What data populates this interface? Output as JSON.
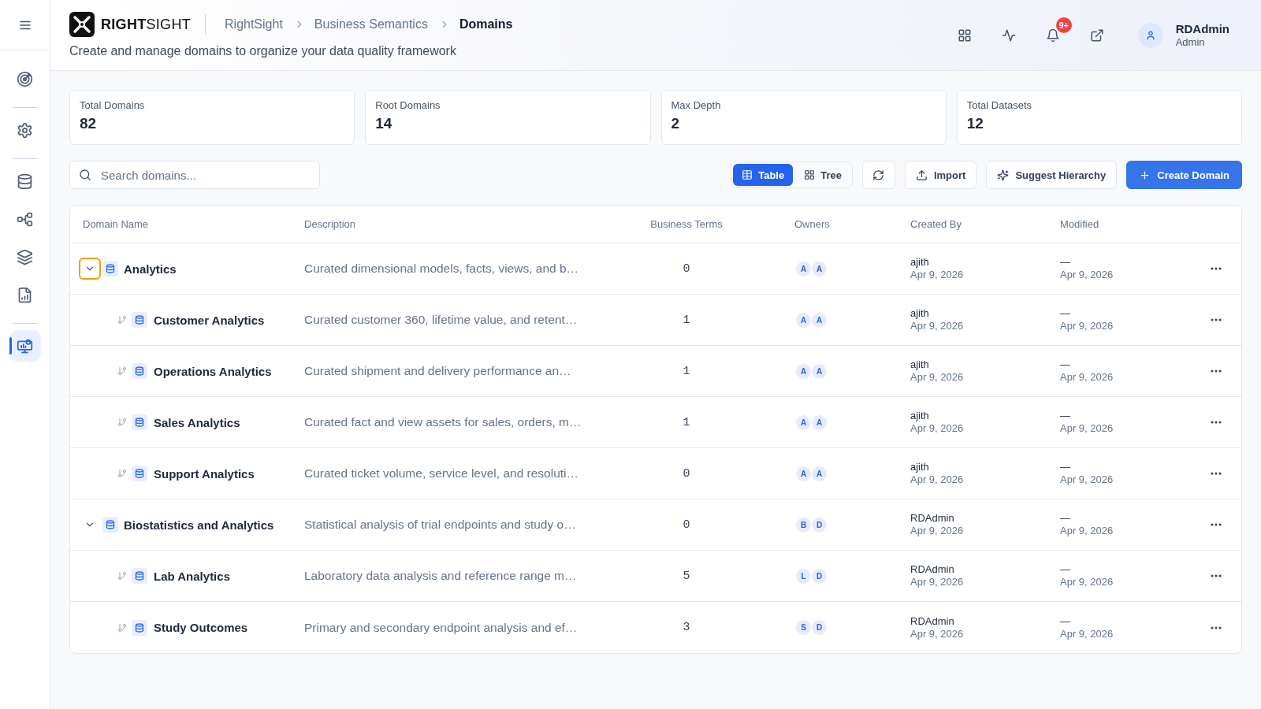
{
  "sidebar": {
    "groups": [
      [
        {
          "selected": false
        }
      ],
      [
        {
          "selected": false
        }
      ],
      [
        {
          "selected": false
        },
        {
          "selected": false
        },
        {
          "selected": false
        },
        {
          "selected": false
        }
      ],
      [
        {
          "selected": true
        }
      ]
    ]
  },
  "header": {
    "logo": "**RIGHT**SIGHT",
    "breadcrumb": [
      {
        "label": "RightSight",
        "current": false
      },
      {
        "label": "Business Semantics",
        "current": false
      },
      {
        "label": "Domains",
        "current": true
      }
    ],
    "subtitle": "Create and manage domains to organize your data quality framework",
    "notification_count": "9+",
    "user": {
      "name": "RDAdmin",
      "role": "Admin"
    }
  },
  "stats": [
    {
      "label": "Total Domains",
      "value": "82"
    },
    {
      "label": "Root Domains",
      "value": "14"
    },
    {
      "label": "Max Depth",
      "value": "2"
    },
    {
      "label": "Total Datasets",
      "value": "12"
    }
  ],
  "toolbar": {
    "search": {
      "placeholder": "Search domains..."
    },
    "views": [
      {
        "label": "Table",
        "selected": true
      },
      {
        "label": "Tree",
        "selected": false
      }
    ],
    "buttons": [
      {
        "kind": "icon"
      },
      {
        "kind": "outline",
        "label": "Import"
      },
      {
        "kind": "outline",
        "label": "Suggest Hierarchy"
      },
      {
        "kind": "primary",
        "label": "Create Domain"
      }
    ]
  },
  "table": {
    "columns": [
      "Domain Name",
      "Description",
      "Business Terms",
      "Owners",
      "Created By",
      "Modified"
    ],
    "rows": [
      {
        "name": "Analytics",
        "description": "Curated dimensional models, facts, views, and b…",
        "business_terms": "0",
        "owners": [
          "A",
          "A"
        ],
        "created_by": "ajith",
        "created_date": "Apr 9, 2026",
        "modified_by": "—",
        "modified_date": "Apr 9, 2026",
        "expanded": true,
        "focused": true,
        "children": [
          {
            "name": "Customer Analytics",
            "description": "Curated customer 360, lifetime value, and retent…",
            "business_terms": "1",
            "owners": [
              "A",
              "A"
            ],
            "created_by": "ajith",
            "created_date": "Apr 9, 2026",
            "modified_by": "—",
            "modified_date": "Apr 9, 2026"
          },
          {
            "name": "Operations Analytics",
            "description": "Curated shipment and delivery performance an…",
            "business_terms": "1",
            "owners": [
              "A",
              "A"
            ],
            "created_by": "ajith",
            "created_date": "Apr 9, 2026",
            "modified_by": "—",
            "modified_date": "Apr 9, 2026"
          },
          {
            "name": "Sales Analytics",
            "description": "Curated fact and view assets for sales, orders, m…",
            "business_terms": "1",
            "owners": [
              "A",
              "A"
            ],
            "created_by": "ajith",
            "created_date": "Apr 9, 2026",
            "modified_by": "—",
            "modified_date": "Apr 9, 2026"
          },
          {
            "name": "Support Analytics",
            "description": "Curated ticket volume, service level, and resoluti…",
            "business_terms": "0",
            "owners": [
              "A",
              "A"
            ],
            "created_by": "ajith",
            "created_date": "Apr 9, 2026",
            "modified_by": "—",
            "modified_date": "Apr 9, 2026"
          }
        ]
      },
      {
        "name": "Biostatistics and Analytics",
        "description": "Statistical analysis of trial endpoints and study o…",
        "business_terms": "0",
        "owners": [
          "B",
          "D"
        ],
        "created_by": "RDAdmin",
        "created_date": "Apr 9, 2026",
        "modified_by": "—",
        "modified_date": "Apr 9, 2026",
        "expanded": true,
        "focused": false,
        "children": [
          {
            "name": "Lab Analytics",
            "description": "Laboratory data analysis and reference range m…",
            "business_terms": "5",
            "owners": [
              "L",
              "D"
            ],
            "created_by": "RDAdmin",
            "created_date": "Apr 9, 2026",
            "modified_by": "—",
            "modified_date": "Apr 9, 2026"
          },
          {
            "name": "Study Outcomes",
            "description": "Primary and secondary endpoint analysis and ef…",
            "business_terms": "3",
            "owners": [
              "S",
              "D"
            ],
            "created_by": "RDAdmin",
            "created_date": "Apr 9, 2026",
            "modified_by": "—",
            "modified_date": "Apr 9, 2026"
          }
        ]
      }
    ]
  }
}
